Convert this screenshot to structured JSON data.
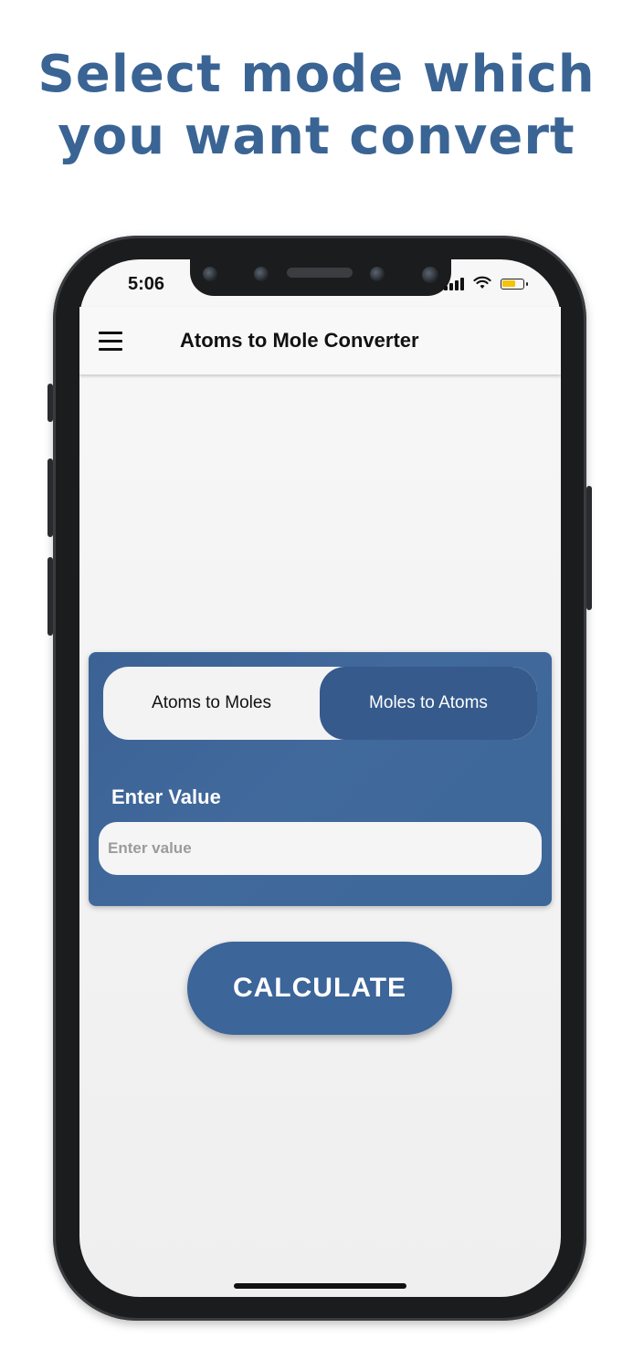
{
  "promo": {
    "line1": "Select mode which",
    "line2": "you want convert"
  },
  "status_bar": {
    "time": "5:06",
    "wifi_icon": "wifi-icon",
    "battery_level": 0.72,
    "battery_color": "#f4c30b"
  },
  "app_bar": {
    "menu_icon": "hamburger-menu-icon",
    "title": "Atoms to Mole Converter"
  },
  "mode_toggle": {
    "options": [
      "Atoms to Moles",
      "Moles to Atoms"
    ],
    "selected": "Moles to Atoms"
  },
  "input_section": {
    "label": "Enter Value",
    "placeholder": "Enter value",
    "value": ""
  },
  "calculate_button": {
    "label": "CALCULATE"
  },
  "colors": {
    "brand": "#3a6494",
    "card": "#3f6698",
    "selected_segment": "#355a8b"
  }
}
